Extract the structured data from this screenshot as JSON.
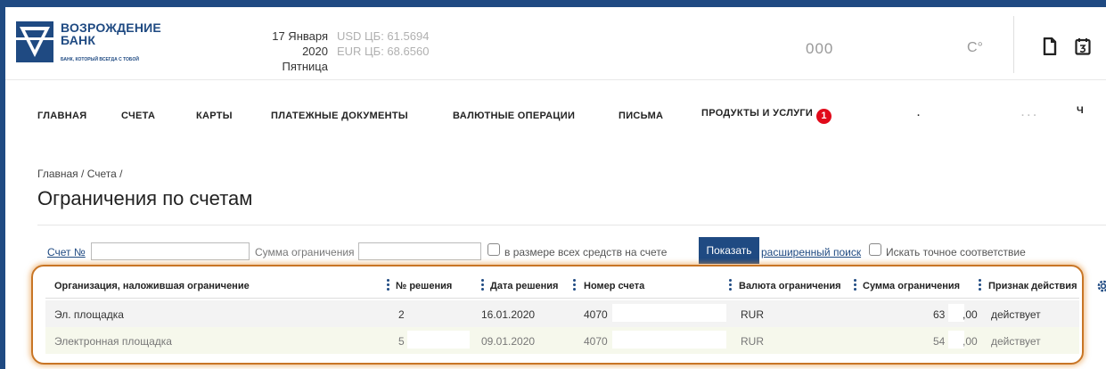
{
  "header": {
    "bank_name_line1": "ВОЗРОЖДЕНИЕ",
    "bank_name_line2": "БАНК",
    "bank_tagline": "БАНК, КОТОРЫЙ ВСЕГДА С ТОБОЙ",
    "date": "17 Января 2020",
    "weekday": "Пятница",
    "usd_rate": "USD ЦБ: 61.5694",
    "eur_rate": "EUR ЦБ: 68.6560",
    "center_code": "000",
    "temperature": "C°",
    "brand_color": "#1f4a82"
  },
  "nav": {
    "items": [
      "ГЛАВНАЯ",
      "СЧЕТА",
      "КАРТЫ",
      "ПЛАТЕЖНЫЕ ДОКУМЕНТЫ",
      "ВАЛЮТНЫЕ ОПЕРАЦИИ",
      "ПИСЬМА",
      "ПРОДУКТЫ И УСЛУГИ"
    ],
    "products_badge": "1",
    "trailing_fragment": "Ч",
    "badge_color": "#e10a1a"
  },
  "breadcrumb": {
    "home": "Главная",
    "accounts": "Счета",
    "separator": "/"
  },
  "page": {
    "title": "Ограничения по счетам"
  },
  "filter": {
    "account_label": "Счет №",
    "account_value": "",
    "amount_label": "Сумма ограничения",
    "amount_value": "",
    "all_funds_label": "в размере всех средств на счете",
    "show_button": "Показать",
    "advanced_search": "расширенный поиск",
    "exact_match_label": "Искать точное соответствие"
  },
  "table": {
    "columns": [
      "Организация, наложившая ограничение",
      "№ решения",
      "Дата решения",
      "Номер счета",
      "Валюта ограничения",
      "Сумма ограничения",
      "Признак действия"
    ],
    "rows": [
      {
        "org": "Эл. площадка",
        "decision_no": "2",
        "decision_date": "16.01.2020",
        "account": "4070",
        "currency": "RUR",
        "amount": "63",
        "amount_cents": ",00",
        "status": "действует"
      },
      {
        "org": "Электронная площадка",
        "decision_no": "5",
        "decision_date": "09.01.2020",
        "account": "4070",
        "currency": "RUR",
        "amount": "54",
        "amount_cents": ",00",
        "status": "действует"
      }
    ],
    "highlight_color": "#c87525"
  }
}
